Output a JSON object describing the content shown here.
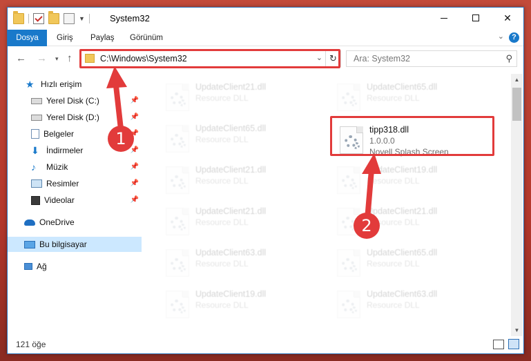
{
  "window": {
    "title": "System32",
    "controls": {
      "minimize": "—",
      "maximize": "",
      "close": "✕"
    }
  },
  "ribbon": {
    "tabs": [
      "Dosya",
      "Giriş",
      "Paylaş",
      "Görünüm"
    ],
    "help": "?"
  },
  "navigation": {
    "address": "C:\\Windows\\System32",
    "search_placeholder": "Ara: System32"
  },
  "sidebar": {
    "items": [
      {
        "label": "Hızlı erişim",
        "icon": "star-icon"
      },
      {
        "label": "Yerel Disk (C:)",
        "icon": "drive-icon",
        "pinned": true
      },
      {
        "label": "Yerel Disk (D:)",
        "icon": "drive-icon",
        "pinned": true
      },
      {
        "label": "Belgeler",
        "icon": "documents-icon",
        "pinned": true
      },
      {
        "label": "İndirmeler",
        "icon": "download-icon",
        "pinned": true
      },
      {
        "label": "Müzik",
        "icon": "music-icon",
        "pinned": true
      },
      {
        "label": "Resimler",
        "icon": "pictures-icon",
        "pinned": true
      },
      {
        "label": "Videolar",
        "icon": "video-icon",
        "pinned": true
      },
      {
        "label": "OneDrive",
        "icon": "cloud-icon"
      },
      {
        "label": "Bu bilgisayar",
        "icon": "computer-icon",
        "selected": true
      },
      {
        "label": "Ağ",
        "icon": "network-icon"
      }
    ]
  },
  "files": [
    {
      "name": "UpdateClient21.dll",
      "type": "Resource DLL"
    },
    {
      "name": "UpdateClient65.dll",
      "type": "Resource DLL"
    },
    {
      "name": "UpdateClient65.dll",
      "type": "Resource DLL"
    },
    {
      "name": "tipp318.dll",
      "version": "1.0.0.0",
      "description": "Novell Splash Screen"
    },
    {
      "name": "UpdateClient21.dll",
      "type": "Resource DLL"
    },
    {
      "name": "UpdateClient19.dll",
      "type": "Resource DLL"
    },
    {
      "name": "UpdateClient21.dll",
      "type": "Resource DLL"
    },
    {
      "name": "UpdateClient21.dll",
      "type": "Resource DLL"
    },
    {
      "name": "UpdateClient63.dll",
      "type": "Resource DLL"
    },
    {
      "name": "UpdateClient65.dll",
      "type": "Resource DLL"
    },
    {
      "name": "UpdateClient19.dll",
      "type": "Resource DLL"
    },
    {
      "name": "UpdateClient63.dll",
      "type": "Resource DLL"
    }
  ],
  "status": {
    "item_count": "121 öğe"
  },
  "annotations": {
    "step1": "1",
    "step2": "2"
  },
  "colors": {
    "accent": "#1979ca",
    "highlight": "#e23b3b",
    "selection": "#cce8ff"
  }
}
